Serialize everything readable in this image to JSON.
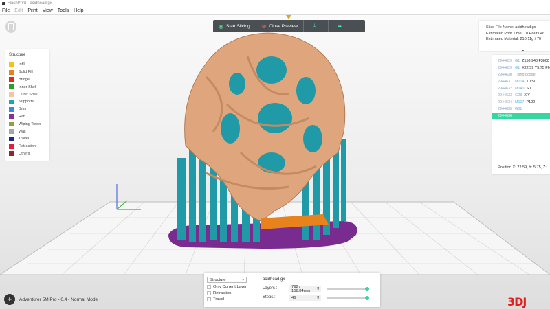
{
  "window": {
    "title": "FlashPrint - acidhead.gx"
  },
  "menu": [
    {
      "label": "File",
      "enabled": true
    },
    {
      "label": "Edit",
      "enabled": false
    },
    {
      "label": "Print",
      "enabled": true
    },
    {
      "label": "View",
      "enabled": true
    },
    {
      "label": "Tools",
      "enabled": true
    },
    {
      "label": "Help",
      "enabled": true
    }
  ],
  "toolbar": {
    "start_slicing": "Start Slicing",
    "close_preview": "Close Preview"
  },
  "legend": {
    "title": "Structure",
    "items": [
      {
        "label": "Infill",
        "color": "#f4c21b"
      },
      {
        "label": "Solid Fill",
        "color": "#e8821c"
      },
      {
        "label": "Bridge",
        "color": "#e02a1c"
      },
      {
        "label": "Inner Shell",
        "color": "#2aa02a"
      },
      {
        "label": "Outer Shell",
        "color": "#f2c6a0"
      },
      {
        "label": "Supports",
        "color": "#1fa5b0"
      },
      {
        "label": "Brim",
        "color": "#3f87e0"
      },
      {
        "label": "Raft",
        "color": "#8a2f93"
      },
      {
        "label": "Wiping Tower",
        "color": "#9b9b3a"
      },
      {
        "label": "Wall",
        "color": "#a6a6a6"
      },
      {
        "label": "Travel",
        "color": "#1c2a8a"
      },
      {
        "label": "Retraction",
        "color": "#e02040"
      },
      {
        "label": "Others",
        "color": "#8a2a2a"
      }
    ]
  },
  "info": {
    "file_name": "Slice File Name:",
    "file_name_value": "acidhead.gx",
    "print_time": "Estimated Print Time:",
    "print_time_value": "10 Hours 46",
    "material": "Estimated Material:",
    "material_value": "210.11g / 70"
  },
  "gcode": {
    "lines": [
      {
        "num": "2944629",
        "cmd": "G1",
        "rest": "Z158.940 F3000",
        "faded": false
      },
      {
        "num": "2944629",
        "cmd": "G1",
        "rest": "X22.59 Y5.75 F60",
        "faded": false
      },
      {
        "num": "2944630",
        "cmd": "",
        "rest": ";end gcode",
        "faded": true
      },
      {
        "num": "2944631",
        "cmd": "M104",
        "rest": "T0 S0",
        "faded": false
      },
      {
        "num": "2944632",
        "cmd": "M140",
        "rest": "S0",
        "faded": false
      },
      {
        "num": "2944633",
        "cmd": "G28",
        "rest": "X Y",
        "faded": false
      },
      {
        "num": "2944634",
        "cmd": "M107",
        "rest": "P102",
        "faded": false
      },
      {
        "num": "2944635",
        "cmd": "G81",
        "rest": "",
        "faded": false
      },
      {
        "num": "2944636",
        "cmd": "",
        "rest": "",
        "faded": false,
        "active": true
      }
    ],
    "position": "Position   X: 22.59, Y: 5.75, Z:"
  },
  "bottom": {
    "structure_select": "Structure",
    "options": [
      "Only Current Layer",
      "Retraction",
      "Travel"
    ],
    "file_name": "acidhead.gx",
    "layers_label": "Layers :",
    "layers_value": "792 / 158.84mm",
    "layers_fraction": 1.0,
    "steps_label": "Steps :",
    "steps_value": "46",
    "steps_fraction": 1.0
  },
  "printer": {
    "label": "Adventurer 5M Pro - 0.4 - Normal Mode"
  },
  "watermark": {
    "text": "3DJ"
  }
}
